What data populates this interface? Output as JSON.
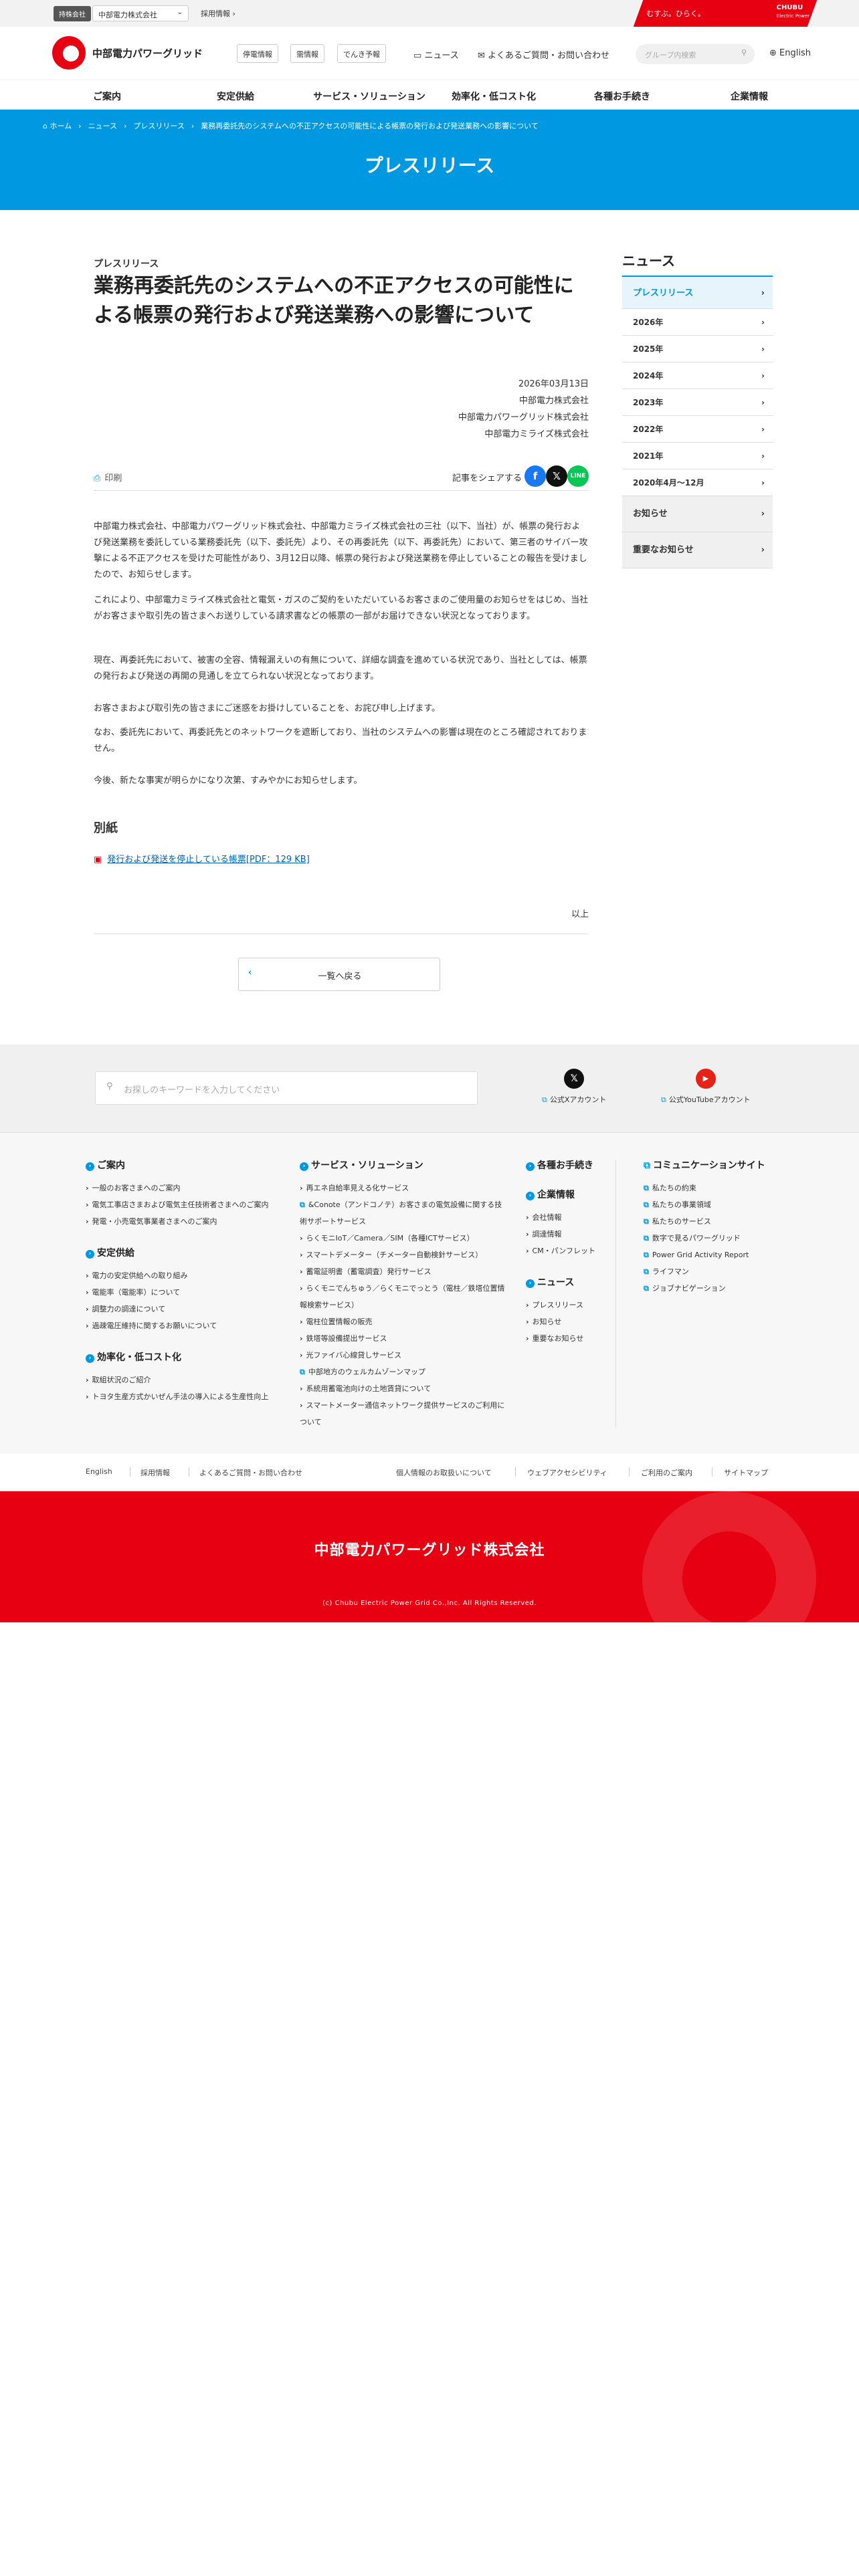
{
  "util": {
    "group_tag": "持株会社",
    "company_select": "中部電力株式会社",
    "recruit": "採用情報 ›",
    "brand_tagline": "むすぶ。ひらく。",
    "brand_logo": "CHUBU",
    "brand_logo_sub": "Electric Power"
  },
  "header": {
    "logo_text": "中部電力パワーグリッド",
    "btn_outage": "停電情報",
    "btn_planned": "需情報",
    "btn_forecast": "でんき予報",
    "news": "ニュース",
    "faq": "よくあるご質問・お問い合わせ",
    "search_placeholder": "グループ内検索",
    "english": "English"
  },
  "gnav": [
    "ご案内",
    "安定供給",
    "サービス・ソリューション",
    "効率化・低コスト化",
    "各種お手続き",
    "企業情報"
  ],
  "breadcrumb": {
    "home": "ホーム",
    "news": "ニュース",
    "press": "プレスリリース",
    "current": "業務再委託先のシステムへの不正アクセスの可能性による帳票の発行および発送業務への影響について"
  },
  "page_title": "プレスリリース",
  "article": {
    "kicker": "プレスリリース",
    "title": "業務再委託先のシステムへの不正アクセスの可能性による帳票の発行および発送業務への影響について",
    "date": "2026年03月13日",
    "orgs": [
      "中部電力株式会社",
      "中部電力パワーグリッド株式会社",
      "中部電力ミライズ株式会社"
    ],
    "print": "印刷",
    "share_label": "記事をシェアする",
    "paragraphs": [
      "中部電力株式会社、中部電力パワーグリッド株式会社、中部電力ミライズ株式会社の三社（以下、当社）が、帳票の発行および発送業務を委託している業務委託先（以下、委託先）より、その再委託先（以下、再委託先）において、第三者のサイバー攻撃による不正アクセスを受けた可能性があり、3月12日以降、帳票の発行および発送業務を停止していることの報告を受けましたので、お知らせします。",
      "これにより、中部電力ミライズ株式会社と電気・ガスのご契約をいただいているお客さまのご使用量のお知らせをはじめ、当社がお客さまや取引先の皆さまへお送りしている請求書などの帳票の一部がお届けできない状況となっております。",
      "現在、再委託先において、被害の全容、情報漏えいの有無について、詳細な調査を進めている状況であり、当社としては、帳票の発行および発送の再開の見通しを立てられない状況となっております。",
      "お客さまおよび取引先の皆さまにご迷惑をお掛けしていることを、お詫び申し上げます。",
      "なお、委託先において、再委託先とのネットワークを遮断しており、当社のシステムへの影響は現在のところ確認されておりません。",
      "今後、新たな事実が明らかになり次第、すみやかにお知らせします。"
    ],
    "annex_title": "別紙",
    "pdf_link": "発行および発送を停止している帳票[PDF：129 KB]",
    "end": "以上",
    "back": "一覧へ戻る"
  },
  "sidebar": {
    "title": "ニュース",
    "items": [
      "プレスリリース",
      "2026年",
      "2025年",
      "2024年",
      "2023年",
      "2022年",
      "2021年",
      "2020年4月～12月",
      "お知らせ",
      "重要なお知らせ"
    ]
  },
  "search_band": {
    "placeholder": "お探しのキーワードを入力してください",
    "x_label": "公式Xアカウント",
    "yt_label": "公式YouTubeアカウント"
  },
  "footer": {
    "col1": [
      {
        "title": "ご案内",
        "items": [
          "一般のお客さまへのご案内",
          "電気工事店さまおよび電気主任技術者さまへのご案内",
          "発電・小売電気事業者さまへのご案内"
        ]
      },
      {
        "title": "安定供給",
        "items": [
          "電力の安定供給への取り組み",
          "電能率（電能率）について",
          "調整力の調達について",
          "過疎電圧維持に関するお願いについて"
        ]
      },
      {
        "title": "効率化・低コスト化",
        "items": [
          "取組状況のご紹介",
          "トヨタ生産方式かいぜん手法の導入による生産性向上"
        ]
      }
    ],
    "col2": [
      {
        "title": "サービス・ソリューション",
        "items": [
          "再エネ自給率見える化サービス",
          "&Conote（アンドコノテ）お客さまの電気設備に関する技術サポートサービス",
          "らくモニIoT／Camera／SIM（各種ICTサービス）",
          "スマートデメーター（チメーター自動検針サービス）",
          "蓄電証明書（蓄電調査）発行サービス",
          "らくモニでんちゅう／らくモニでっとう（電柱／鉄塔位置情報検索サービス）",
          "電柱位置情報の販売",
          "鉄塔等設備提出サービス",
          "光ファイバ心線貸しサービス",
          "中部地方のウェルカムゾーンマップ",
          "系統用蓄電池向けの土地賃貸について",
          "スマートメーター通信ネットワーク提供サービスのご利用について"
        ]
      }
    ],
    "col3": [
      {
        "title": "各種お手続き",
        "items": []
      },
      {
        "title": "企業情報",
        "items": [
          "会社情報",
          "調達情報",
          "CM・パンフレット"
        ]
      },
      {
        "title": "ニュース",
        "items": [
          "プレスリリース",
          "お知らせ",
          "重要なお知らせ"
        ]
      }
    ],
    "col4": [
      {
        "title": "コミュニケーションサイト",
        "items": [
          "私たちの約束",
          "私たちの事業領域",
          "私たちのサービス",
          "数字で見るパワーグリッド",
          "Power Grid Activity Report",
          "ライフマン",
          "ジョブナビゲーション"
        ]
      }
    ],
    "bottom_links": [
      "English",
      "採用情報",
      "よくあるご質問・お問い合わせ",
      "個人情報のお取扱いについて",
      "ウェブアクセシビリティ",
      "ご利用のご案内",
      "サイトマップ"
    ],
    "company": "中部電力パワーグリッド株式会社",
    "copyright": "(c) Chubu Electric Power Grid Co.,Inc. All Rights Reserved."
  },
  "colors": {
    "brand_red": "#e60012",
    "accent_blue": "#0098e0",
    "link_blue": "#0060b0"
  }
}
